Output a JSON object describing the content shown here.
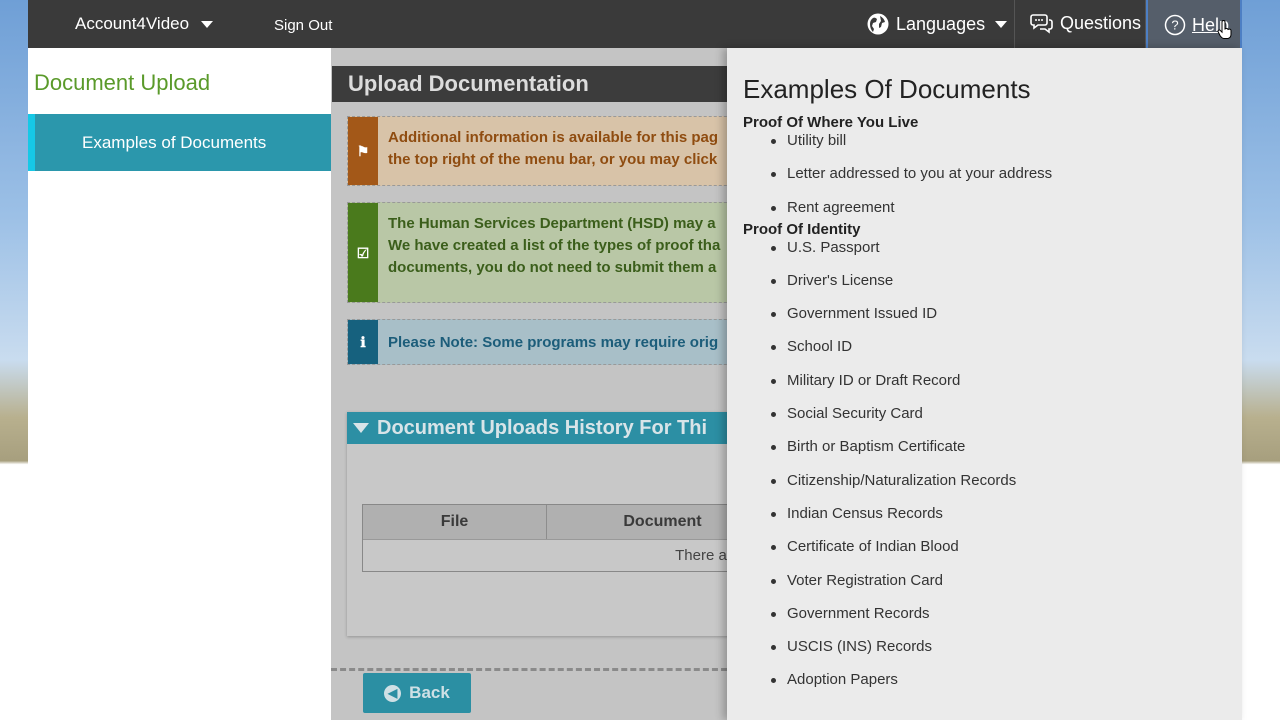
{
  "nav": {
    "account_label": "Account4Video",
    "signout_label": "Sign Out",
    "languages_label": "Languages",
    "questions_label": "Questions",
    "help_label": "Help"
  },
  "sidebar": {
    "title": "Document Upload",
    "items": [
      {
        "label": "Examples of Documents"
      }
    ]
  },
  "main": {
    "title": "Upload Documentation",
    "alerts": [
      {
        "type": "warning",
        "line1": "Additional information is available for this pag",
        "line2": "the top right of the menu bar, or you may click"
      },
      {
        "type": "success",
        "line1": "The Human Services Department (HSD) may a",
        "line2": "We have created a list of the types of proof tha",
        "line3": "documents, you do not need to submit them a"
      },
      {
        "type": "info",
        "line1": "Please Note: Some programs may require orig"
      }
    ],
    "history": {
      "title": "Document Uploads History For Thi",
      "columns": [
        "File",
        "Document"
      ],
      "empty_text": "There are no"
    },
    "back_label": "Back"
  },
  "help_panel": {
    "title": "Examples Of Documents",
    "sections": [
      {
        "heading": "Proof Of Where You Live",
        "items": [
          "Utility bill",
          "Letter addressed to you at your address",
          "Rent agreement"
        ]
      },
      {
        "heading": "Proof Of Identity",
        "items": [
          "U.S. Passport",
          "Driver's License",
          "Government Issued ID",
          "School ID",
          "Military ID or Draft Record",
          "Social Security Card",
          "Birth or Baptism Certificate",
          "Citizenship/Naturalization Records",
          "Indian Census Records",
          "Certificate of Indian Blood",
          "Voter Registration Card",
          "Government Records",
          "USCIS (INS) Records",
          "Adoption Papers"
        ]
      }
    ]
  },
  "colors": {
    "topbar": "#3a3a3a",
    "accent_teal": "#2b97ac",
    "sidebar_title": "#5a9a2a",
    "help_panel_bg": "#ebebeb"
  }
}
